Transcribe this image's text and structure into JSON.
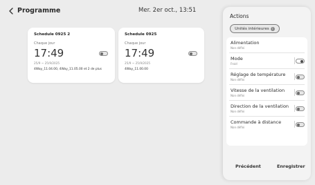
{
  "header": {
    "back_icon": "chevron-left-icon",
    "title": "Programme",
    "datetime": "Mer. 2er oct., 13:51"
  },
  "schedules": [
    {
      "name": "Schedule 0925 2",
      "frequency": "Chaque jour",
      "time": "17:49",
      "dates": "25/9 ~ 25/9/2025",
      "description": "4Way_11.04.00, 4Way_11.05.00 et 2 de plus",
      "enabled": false
    },
    {
      "name": "Schedule 0925",
      "frequency": "Chaque jour",
      "time": "17:49",
      "dates": "25/9 ~ 25/9/2025",
      "description": "4Way_11.00.00",
      "enabled": false
    }
  ],
  "panel": {
    "title": "Actions",
    "unit_chip": "Unités intérieures",
    "unit_chip_icon": "info-icon",
    "actions": [
      {
        "title": "Alimentation",
        "value": "Non défini",
        "has_toggle": false,
        "on": false
      },
      {
        "title": "Mode",
        "value": "Froid",
        "has_toggle": true,
        "on": true
      },
      {
        "title": "Réglage de température",
        "value": "Non défini",
        "has_toggle": true,
        "on": false
      },
      {
        "title": "Vitesse de la ventilation",
        "value": "Non défini",
        "has_toggle": true,
        "on": false
      },
      {
        "title": "Direction de la ventilation",
        "value": "Non défini",
        "has_toggle": true,
        "on": false
      },
      {
        "title": "Commande à distance",
        "value": "Non défini",
        "has_toggle": true,
        "on": false
      }
    ],
    "prev_button": "Précédent",
    "save_button": "Enregistrer"
  }
}
